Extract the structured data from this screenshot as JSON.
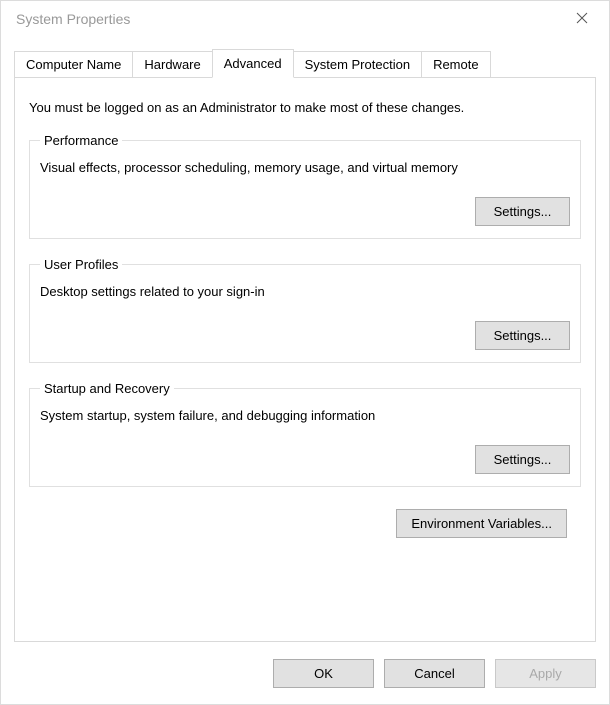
{
  "window": {
    "title": "System Properties"
  },
  "tabs": {
    "computer_name": "Computer Name",
    "hardware": "Hardware",
    "advanced": "Advanced",
    "system_protection": "System Protection",
    "remote": "Remote"
  },
  "advanced_tab": {
    "notice": "You must be logged on as an Administrator to make most of these changes.",
    "performance": {
      "legend": "Performance",
      "description": "Visual effects, processor scheduling, memory usage, and virtual memory",
      "button": "Settings..."
    },
    "user_profiles": {
      "legend": "User Profiles",
      "description": "Desktop settings related to your sign-in",
      "button": "Settings..."
    },
    "startup_recovery": {
      "legend": "Startup and Recovery",
      "description": "System startup, system failure, and debugging information",
      "button": "Settings..."
    },
    "env_vars_button": "Environment Variables..."
  },
  "footer": {
    "ok": "OK",
    "cancel": "Cancel",
    "apply": "Apply"
  }
}
